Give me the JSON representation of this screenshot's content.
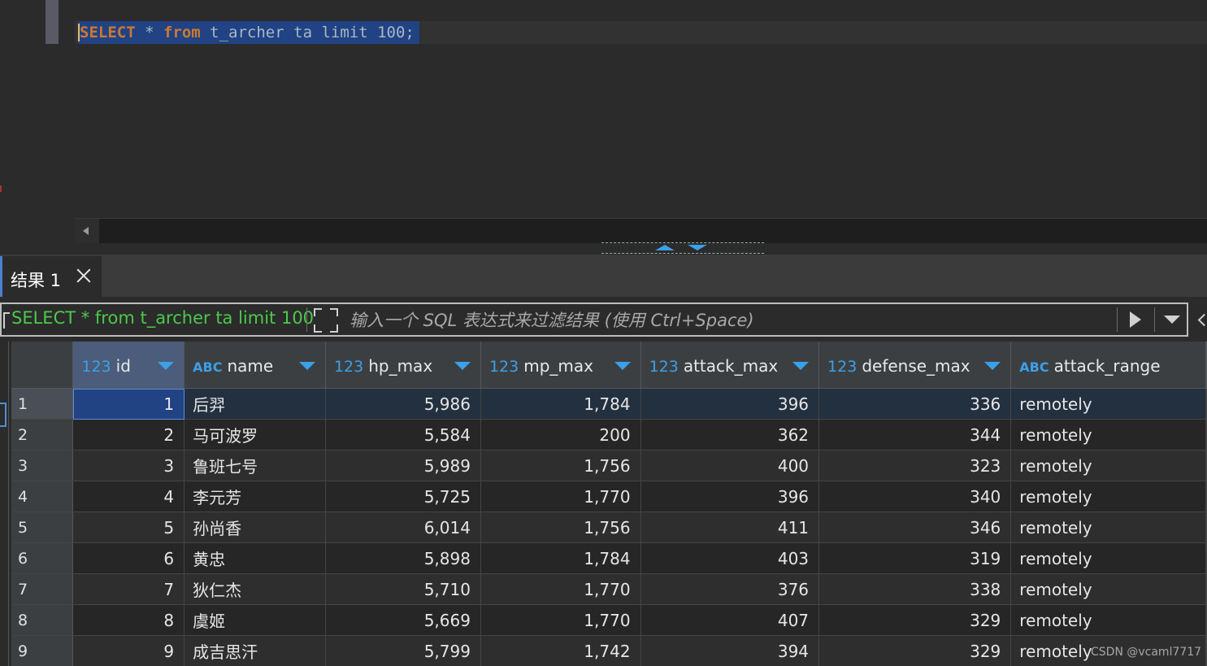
{
  "editor": {
    "tokens": [
      {
        "text": "SELECT",
        "kind": "kw"
      },
      {
        "text": " * ",
        "kind": "op"
      },
      {
        "text": "from",
        "kind": "kw"
      },
      {
        "text": " t_archer ta ",
        "kind": "op"
      },
      {
        "text": "limit",
        "kind": "op"
      },
      {
        "text": " 100;",
        "kind": "op"
      }
    ]
  },
  "results": {
    "tab_label": "结果 1",
    "query_text": "SELECT * from t_archer ta limit 100",
    "filter_placeholder": "输入一个 SQL 表达式来过滤结果 (使用 Ctrl+Space)"
  },
  "grid": {
    "columns": [
      {
        "type": "123",
        "name": "id"
      },
      {
        "type": "ABC",
        "name": "name"
      },
      {
        "type": "123",
        "name": "hp_max"
      },
      {
        "type": "123",
        "name": "mp_max"
      },
      {
        "type": "123",
        "name": "attack_max"
      },
      {
        "type": "123",
        "name": "defense_max"
      },
      {
        "type": "ABC",
        "name": "attack_range"
      }
    ],
    "rows": [
      {
        "n": "1",
        "id": "1",
        "name": "后羿",
        "hp_max": "5,986",
        "mp_max": "1,784",
        "attack_max": "396",
        "defense_max": "336",
        "attack_range": "remotely"
      },
      {
        "n": "2",
        "id": "2",
        "name": "马可波罗",
        "hp_max": "5,584",
        "mp_max": "200",
        "attack_max": "362",
        "defense_max": "344",
        "attack_range": "remotely"
      },
      {
        "n": "3",
        "id": "3",
        "name": "鲁班七号",
        "hp_max": "5,989",
        "mp_max": "1,756",
        "attack_max": "400",
        "defense_max": "323",
        "attack_range": "remotely"
      },
      {
        "n": "4",
        "id": "4",
        "name": "李元芳",
        "hp_max": "5,725",
        "mp_max": "1,770",
        "attack_max": "396",
        "defense_max": "340",
        "attack_range": "remotely"
      },
      {
        "n": "5",
        "id": "5",
        "name": "孙尚香",
        "hp_max": "6,014",
        "mp_max": "1,756",
        "attack_max": "411",
        "defense_max": "346",
        "attack_range": "remotely"
      },
      {
        "n": "6",
        "id": "6",
        "name": "黄忠",
        "hp_max": "5,898",
        "mp_max": "1,784",
        "attack_max": "403",
        "defense_max": "319",
        "attack_range": "remotely"
      },
      {
        "n": "7",
        "id": "7",
        "name": "狄仁杰",
        "hp_max": "5,710",
        "mp_max": "1,770",
        "attack_max": "376",
        "defense_max": "338",
        "attack_range": "remotely"
      },
      {
        "n": "8",
        "id": "8",
        "name": "虞姬",
        "hp_max": "5,669",
        "mp_max": "1,770",
        "attack_max": "407",
        "defense_max": "329",
        "attack_range": "remotely"
      },
      {
        "n": "9",
        "id": "9",
        "name": "成吉思汗",
        "hp_max": "5,799",
        "mp_max": "1,742",
        "attack_max": "394",
        "defense_max": "329",
        "attack_range": "remotely"
      }
    ]
  },
  "watermark": "CSDN @vcaml7717",
  "colors": {
    "keyword": "#cc7832",
    "type_badge": "#3ba0e8",
    "query_text": "#4bc94b",
    "selection": "#214283"
  }
}
